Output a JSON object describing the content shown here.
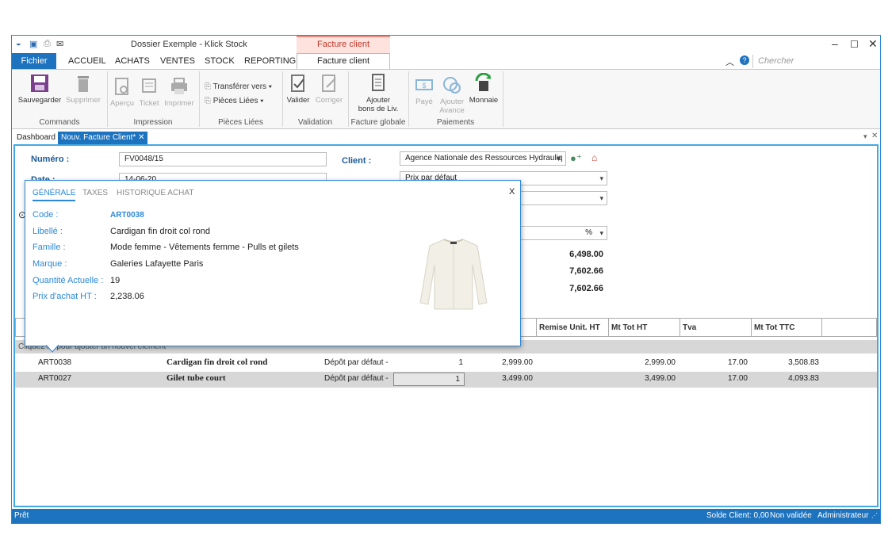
{
  "window": {
    "title": "Dossier Exemple - Klick Stock",
    "context_tab": "Facture client",
    "search_placeholder": "Chercher"
  },
  "menu": [
    "Fichier",
    "ACCUEIL",
    "ACHATS",
    "VENTES",
    "STOCK",
    "REPORTING",
    "Facture client"
  ],
  "ribbon": {
    "commands": {
      "label": "Commands",
      "save": "Sauvegarder",
      "delete": "Supprimer"
    },
    "impression": {
      "label": "Impression",
      "preview": "Aperçu",
      "ticket": "Ticket",
      "print": "Imprimer"
    },
    "pieces": {
      "label": "Pièces Liées",
      "transfer": "Transférer vers",
      "linked": "Pièces Liées"
    },
    "validation": {
      "label": "Validation",
      "validate": "Valider",
      "correct": "Corriger"
    },
    "facture": {
      "label": "Facture globale",
      "add_line1": "Ajouter",
      "add_line2": "bons de Liv."
    },
    "paiements": {
      "label": "Paiements",
      "paid": "Payé",
      "add_adv1": "Ajouter",
      "add_adv2": "Avance",
      "money": "Monnaie"
    }
  },
  "doc_tabs": {
    "dashboard": "Dashboard",
    "active": "Nouv. Facture Client*"
  },
  "form": {
    "numero_label": "Numéro :",
    "numero_value": "FV0048/15",
    "date_label": "Date :",
    "date_value": "14-06-20",
    "client_label": "Client :",
    "client_value": "Agence Nationale des Ressources Hydrauliq",
    "tarif_value": "Prix par défaut",
    "percent": "%",
    "totals": [
      "6,498.00",
      "7,602.66",
      "7,602.66"
    ]
  },
  "table": {
    "headers": [
      "Remise Unit. HT",
      "Mt Tot HT",
      "Tva",
      "Mt Tot TTC"
    ],
    "click_hint": "Cliquez ici pour ajouter un nouvel élément",
    "rows": [
      {
        "code": "ART0038",
        "label": "Cardigan fin droit col rond",
        "depot": "Dépôt par défaut -",
        "qty": "1",
        "pu": "2,999.00",
        "mtht": "2,999.00",
        "tva": "17.00",
        "ttc": "3,508.83"
      },
      {
        "code": "ART0027",
        "label": "Gilet tube court",
        "depot": "Dépôt par défaut -",
        "qty": "1",
        "pu": "3,499.00",
        "mtht": "3,499.00",
        "tva": "17.00",
        "ttc": "4,093.83"
      }
    ]
  },
  "popup": {
    "tabs": [
      "GÉNÉRALE",
      "TAXES",
      "HISTORIQUE ACHAT"
    ],
    "close": "X",
    "code_label": "Code :",
    "code_value": "ART0038",
    "libelle_label": "Libellé :",
    "libelle_value": "Cardigan fin droit col rond",
    "famille_label": "Famille :",
    "famille_value": "Mode femme - Vêtements femme - Pulls et gilets",
    "marque_label": "Marque :",
    "marque_value": "Galeries Lafayette Paris",
    "qte_label": "Quantité Actuelle :",
    "qte_value": "19",
    "prix_label": "Prix d'achat HT :",
    "prix_value": "2,238.06"
  },
  "status": {
    "left": "Prêt",
    "solde": "Solde Client: 0,00",
    "etat": "Non validée",
    "user": "Administrateur"
  },
  "colors": {
    "accent": "#1e73be",
    "context": "#e88c80",
    "label": "#1d5a96"
  }
}
